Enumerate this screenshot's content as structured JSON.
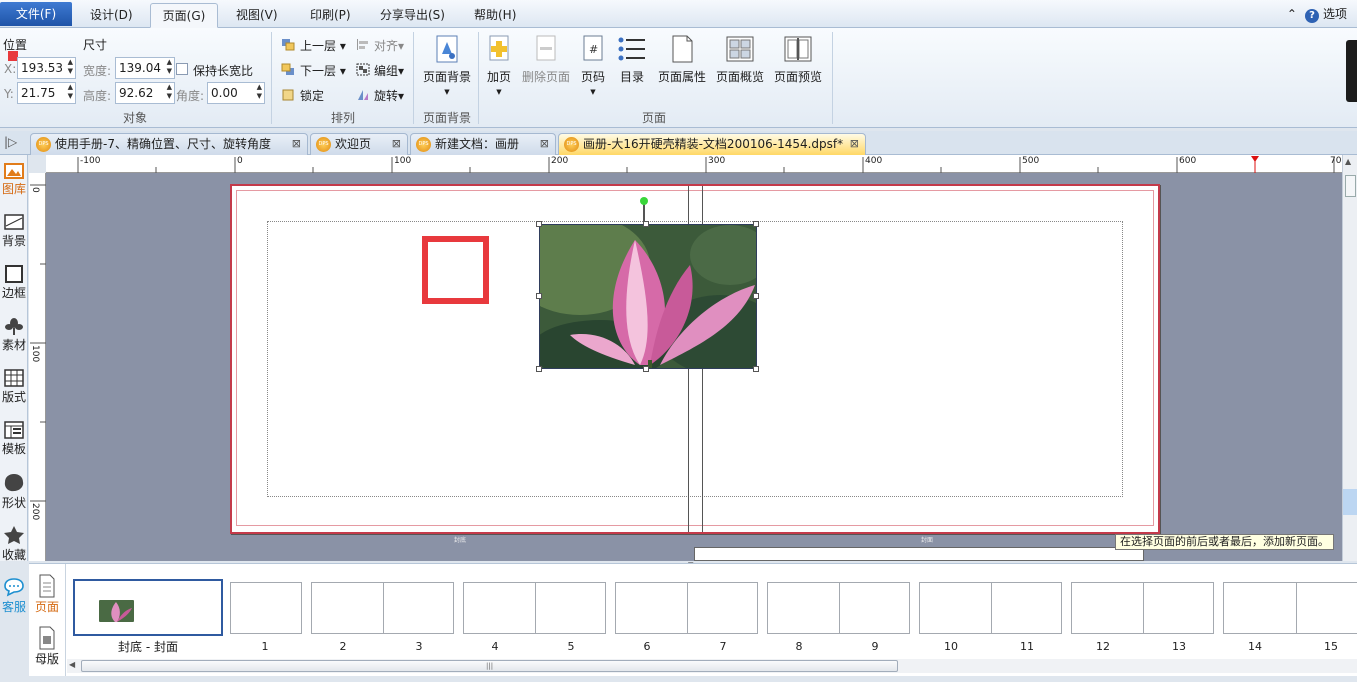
{
  "menu": {
    "file": "文件(F)",
    "design": "设计(D)",
    "page": "页面(G)",
    "view": "视图(V)",
    "print": "印刷(P)",
    "share": "分享导出(S)",
    "help": "帮助(H)",
    "options": "选项"
  },
  "ribbon": {
    "position_label": "位置",
    "size_label": "尺寸",
    "x_label": "X:",
    "x_value": "193.53",
    "y_label": "Y:",
    "y_value": "21.75",
    "width_label": "宽度:",
    "width_value": "139.04",
    "height_label": "高度:",
    "height_value": "92.62",
    "angle_label": "角度:",
    "angle_value": "0.00",
    "keep_ratio": "保持长宽比",
    "group_object": "对象",
    "bring_forward": "上一层",
    "send_backward": "下一层",
    "lock": "锁定",
    "align": "对齐",
    "group": "编组",
    "rotate": "旋转",
    "group_arrange": "排列",
    "page_bg": "页面背景",
    "group_page_bg": "页面背景",
    "add_page": "加页",
    "delete_page": "删除页面",
    "page_number": "页码",
    "toc": "目录",
    "page_props": "页面属性",
    "page_overview": "页面概览",
    "page_preview": "页面预览",
    "group_page": "页面"
  },
  "tabs": [
    {
      "label": "使用手册-7、精确位置、尺寸、旋转角度"
    },
    {
      "label": "欢迎页"
    },
    {
      "label": "新建文档：画册"
    },
    {
      "label": "画册-大16开硬壳精装-文档200106-1454.dpsf*"
    }
  ],
  "left_tools": [
    "图库",
    "背景",
    "边框",
    "素材",
    "版式",
    "模板",
    "形状",
    "收藏",
    "客服"
  ],
  "ruler_h": [
    "-100",
    "0",
    "100",
    "200",
    "300",
    "400",
    "500",
    "600",
    "70"
  ],
  "ruler_v": [
    "0",
    "100",
    "200"
  ],
  "spread": {
    "left_footer": "封底",
    "right_footer": "封面"
  },
  "tooltip": "在选择页面的前后或者最后，添加新页面。",
  "bottom": {
    "page_tab": "页面",
    "master_tab": "母版",
    "cover_label": "封底 - 封面",
    "page_numbers": [
      "1",
      "2",
      "3",
      "4",
      "5",
      "6",
      "7",
      "8",
      "9",
      "10",
      "11",
      "12",
      "13",
      "14",
      "15"
    ]
  },
  "colors": {
    "accent": "#2e62b3",
    "red_square": "#e8393d",
    "selection": "#2f3d5c"
  }
}
